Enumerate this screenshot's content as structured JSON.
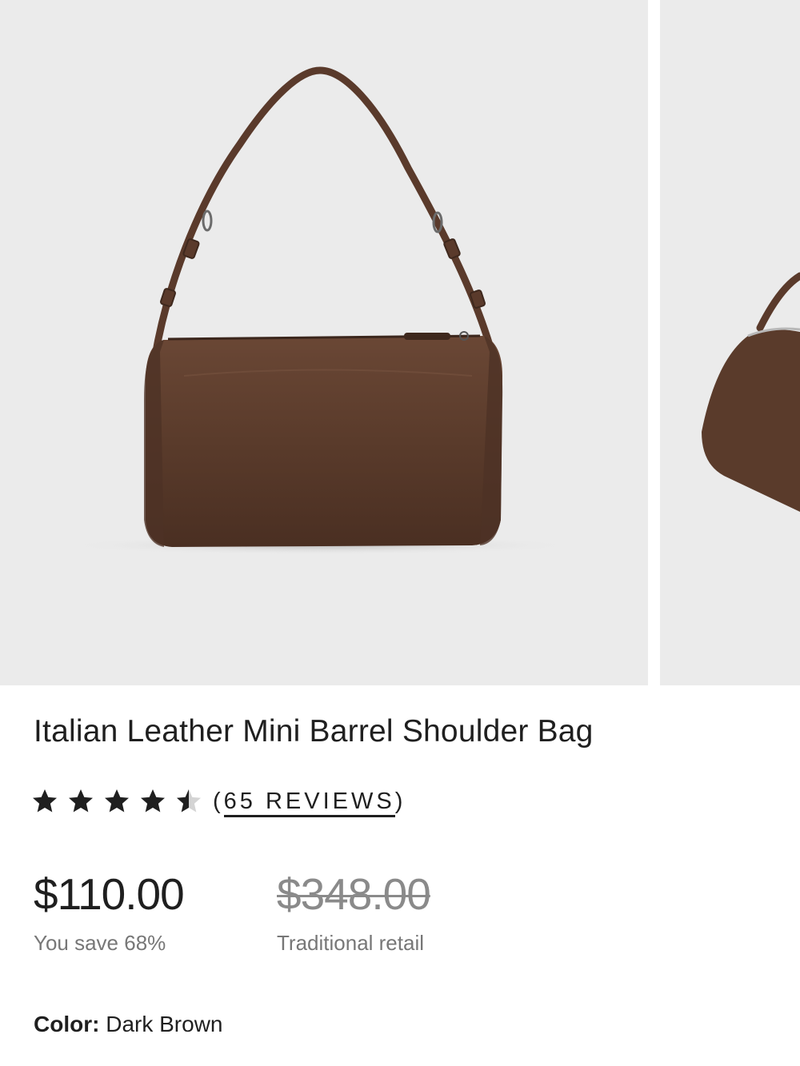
{
  "product": {
    "title": "Italian Leather Mini Barrel Shoulder Bag",
    "rating": {
      "value": 4.5,
      "max": 5,
      "reviews_text": "(65 REVIEWS)"
    },
    "price": {
      "current": "$110.00",
      "savings": "You save 68%",
      "retail": "$348.00",
      "retail_label": "Traditional retail"
    },
    "color": {
      "label": "Color:",
      "value": "Dark Brown"
    }
  },
  "gallery": {
    "images": [
      {
        "alt": "Dark brown leather barrel shoulder bag, front view"
      },
      {
        "alt": "Dark brown leather barrel shoulder bag, angled view"
      }
    ]
  },
  "colors": {
    "leather": "#5c3d2e",
    "background": "#ebebeb",
    "text": "#1f1f1f",
    "muted": "#777777",
    "strike": "#8a8a8a"
  }
}
